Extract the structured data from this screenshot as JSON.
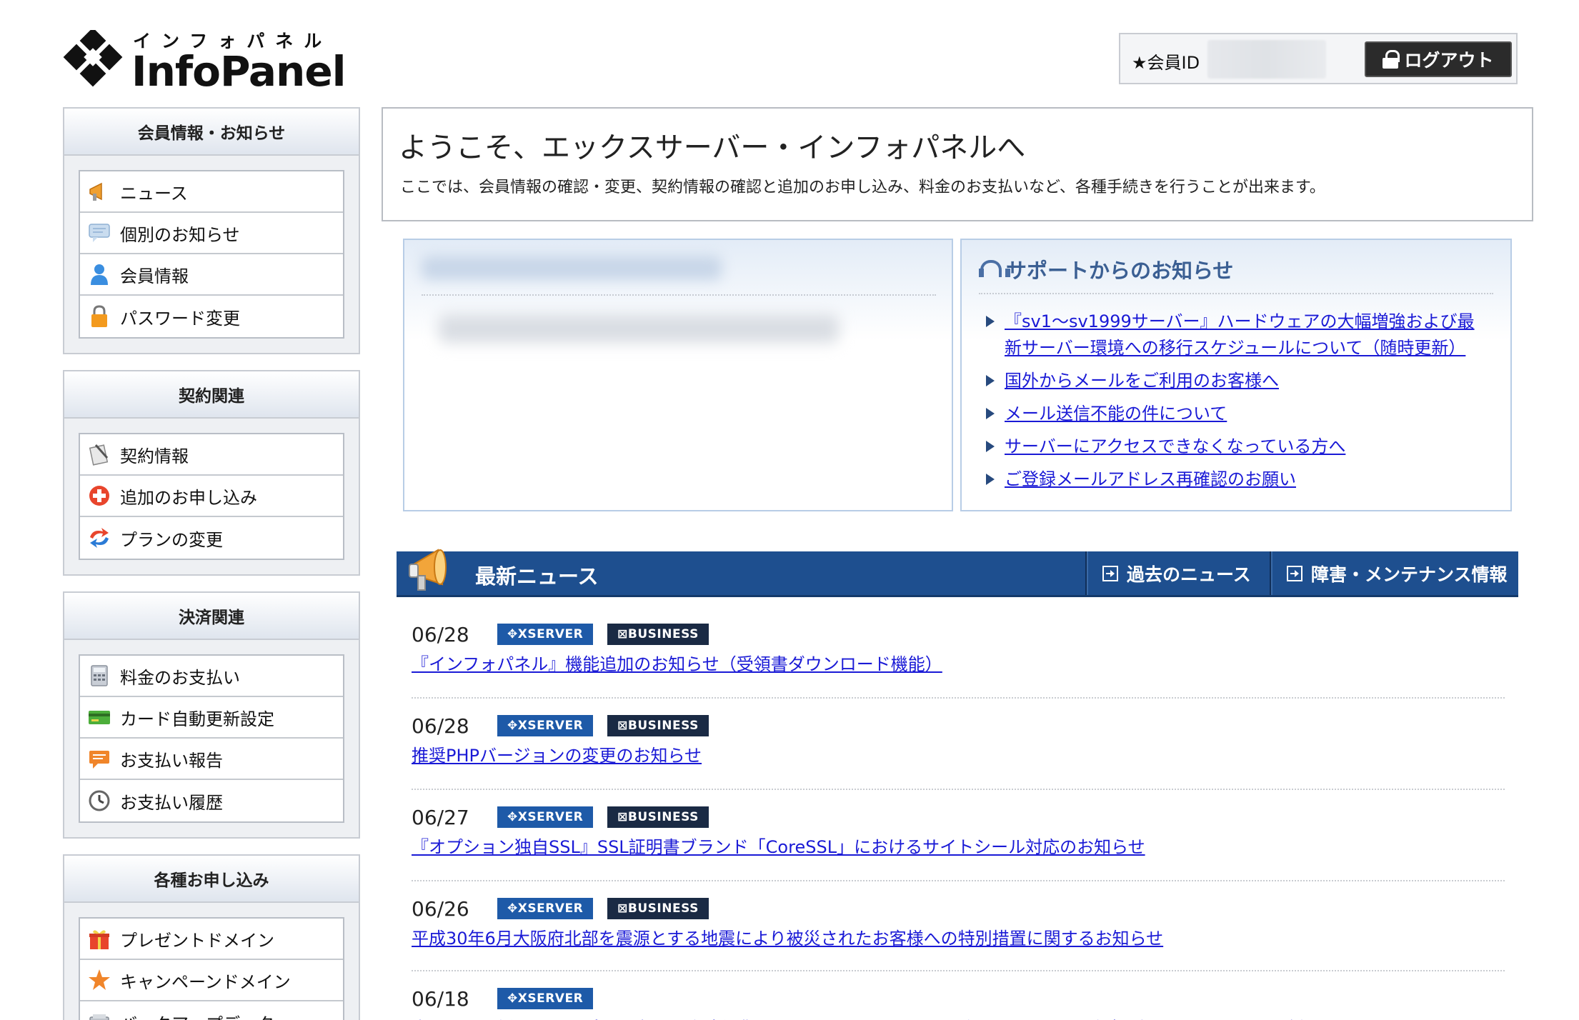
{
  "header": {
    "logo_kana": "インフォパネル",
    "logo_text": "InfoPanel",
    "member_label": "★会員ID",
    "logout_label": "ログアウト"
  },
  "sidebar": {
    "sections": [
      {
        "title": "会員情報・お知らせ",
        "items": [
          {
            "label": "ニュース",
            "icon": "megaphone-icon"
          },
          {
            "label": "個別のお知らせ",
            "icon": "speech-bubble-icon"
          },
          {
            "label": "会員情報",
            "icon": "user-icon"
          },
          {
            "label": "パスワード変更",
            "icon": "lock-icon"
          }
        ]
      },
      {
        "title": "契約関連",
        "items": [
          {
            "label": "契約情報",
            "icon": "contract-icon"
          },
          {
            "label": "追加のお申し込み",
            "icon": "add-icon"
          },
          {
            "label": "プランの変更",
            "icon": "change-icon"
          }
        ]
      },
      {
        "title": "決済関連",
        "items": [
          {
            "label": "料金のお支払い",
            "icon": "calculator-icon"
          },
          {
            "label": "カード自動更新設定",
            "icon": "credit-card-icon"
          },
          {
            "label": "お支払い報告",
            "icon": "report-icon"
          },
          {
            "label": "お支払い履歴",
            "icon": "clock-icon"
          }
        ]
      },
      {
        "title": "各種お申し込み",
        "items": [
          {
            "label": "プレゼントドメイン",
            "icon": "gift-icon"
          },
          {
            "label": "キャンペーンドメイン",
            "icon": "star-icon"
          },
          {
            "label": "バックアップデータ",
            "icon": "backup-icon"
          }
        ]
      }
    ]
  },
  "welcome": {
    "title": "ようこそ、エックスサーバー・インフォパネルへ",
    "description": "ここでは、会員情報の確認・変更、契約情報の確認と追加のお申し込み、料金のお支払いなど、各種手続きを行うことが出来ます。"
  },
  "support": {
    "title": "サポートからのお知らせ",
    "links": [
      "『sv1～sv1999サーバー』ハードウェアの大幅増強および最新サーバー環境への移行スケジュールについて（随時更新）",
      "国外からメールをご利用のお客様へ",
      "メール送信不能の件について",
      "サーバーにアクセスできなくなっている方へ",
      "ご登録メールアドレス再確認のお願い"
    ]
  },
  "newsbar": {
    "title": "最新ニュース",
    "past_news": "過去のニュース",
    "maintenance": "障害・メンテナンス情報"
  },
  "badges": {
    "xserver": "✥XSERVER",
    "business": "⊠BUSINESS"
  },
  "news": [
    {
      "date": "06/28",
      "title": "『インフォパネル』機能追加のお知らせ（受領書ダウンロード機能）"
    },
    {
      "date": "06/28",
      "title": "推奨PHPバージョンの変更のお知らせ"
    },
    {
      "date": "06/27",
      "title": "『オプション独自SSL』SSL証明書ブランド「CoreSSL」におけるサイトシール対応のお知らせ"
    },
    {
      "date": "06/26",
      "title": "平成30年6月大阪府北部を震源とする地震により被災されたお客様への特別措置に関するお知らせ"
    },
    {
      "date": "06/18",
      "title": "本日のお電話によるサポート窓口の臨時休業、およびメールでのお問い合わせについて(随時更新) (6/19 PM6:37追記)"
    }
  ],
  "colors": {
    "newsbar_bg": "#1e4f8f",
    "link": "#1a1ad6",
    "badge_xserver": "#1e5aa8",
    "badge_business": "#1a2a44",
    "support_title": "#3b5f93"
  }
}
